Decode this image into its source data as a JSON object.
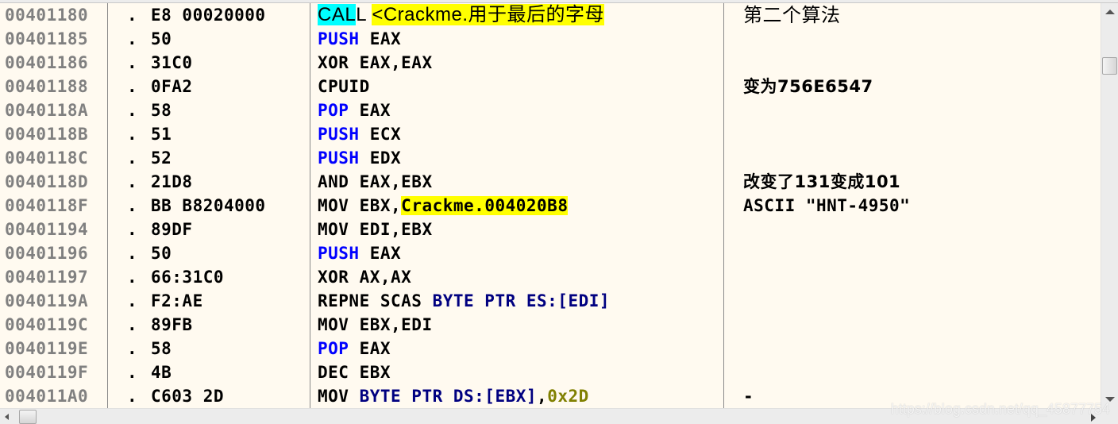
{
  "disassembly": {
    "rows": [
      {
        "address": "00401180",
        "marker": ".",
        "hex": "E8 00020000",
        "mnemonic": "CALL",
        "operand": "<Crackme.用于最后的字母",
        "operand_hl": "yellow",
        "mnemonic_hl": "cyan",
        "comment": "第二个算法"
      },
      {
        "address": "00401185",
        "marker": ".",
        "hex": "50",
        "mnemonic": "PUSH",
        "operand": "EAX",
        "comment": ""
      },
      {
        "address": "00401186",
        "marker": ".",
        "hex": "31C0",
        "mnemonic": "XOR",
        "operand": "EAX,EAX",
        "comment": ""
      },
      {
        "address": "00401188",
        "marker": ".",
        "hex": "0FA2",
        "mnemonic": "CPUID",
        "operand": "",
        "comment": "变为756E6547"
      },
      {
        "address": "0040118A",
        "marker": ".",
        "hex": "58",
        "mnemonic": "POP",
        "operand": "EAX",
        "comment": ""
      },
      {
        "address": "0040118B",
        "marker": ".",
        "hex": "51",
        "mnemonic": "PUSH",
        "operand": "ECX",
        "comment": ""
      },
      {
        "address": "0040118C",
        "marker": ".",
        "hex": "52",
        "mnemonic": "PUSH",
        "operand": "EDX",
        "comment": ""
      },
      {
        "address": "0040118D",
        "marker": ".",
        "hex": "21D8",
        "mnemonic": "AND",
        "operand": "EAX,EBX",
        "comment": "改变了131变成101"
      },
      {
        "address": "0040118F",
        "marker": ".",
        "hex": "BB B8204000",
        "mnemonic": "MOV",
        "operand_prefix": "EBX,",
        "operand": "Crackme.004020B8",
        "operand_hl": "yellow",
        "comment": "ASCII \"HNT-4950\""
      },
      {
        "address": "00401194",
        "marker": ".",
        "hex": "89DF",
        "mnemonic": "MOV",
        "operand": "EDI,EBX",
        "comment": ""
      },
      {
        "address": "00401196",
        "marker": ".",
        "hex": "50",
        "mnemonic": "PUSH",
        "operand": "EAX",
        "comment": ""
      },
      {
        "address": "00401197",
        "marker": ".",
        "hex": "66:31C0",
        "mnemonic": "XOR",
        "operand": "AX,AX",
        "comment": ""
      },
      {
        "address": "0040119A",
        "marker": ".",
        "hex": "F2:AE",
        "mnemonic": "REPNE SCAS",
        "operand": "BYTE PTR ES:[EDI]",
        "comment": ""
      },
      {
        "address": "0040119C",
        "marker": ".",
        "hex": "89FB",
        "mnemonic": "MOV",
        "operand": "EBX,EDI",
        "comment": ""
      },
      {
        "address": "0040119E",
        "marker": ".",
        "hex": "58",
        "mnemonic": "POP",
        "operand": "EAX",
        "comment": ""
      },
      {
        "address": "0040119F",
        "marker": ".",
        "hex": "4B",
        "mnemonic": "DEC",
        "operand": "EBX",
        "comment": ""
      },
      {
        "address": "004011A0",
        "marker": ".",
        "hex": "C603 2D",
        "mnemonic": "MOV",
        "operand": "BYTE PTR DS:[EBX]",
        "operand_suffix": ",",
        "imm": "0x2D",
        "comment": "-"
      }
    ]
  },
  "watermark": "https://blog.csdn.net/qq_45877754",
  "colors": {
    "background": "#fffaf0",
    "address": "#808080",
    "mnemonic_stack": "#0000ff",
    "memory_operand": "#000080",
    "immediate": "#808000",
    "highlight_yellow": "#ffff00",
    "highlight_cyan": "#00ffff"
  }
}
